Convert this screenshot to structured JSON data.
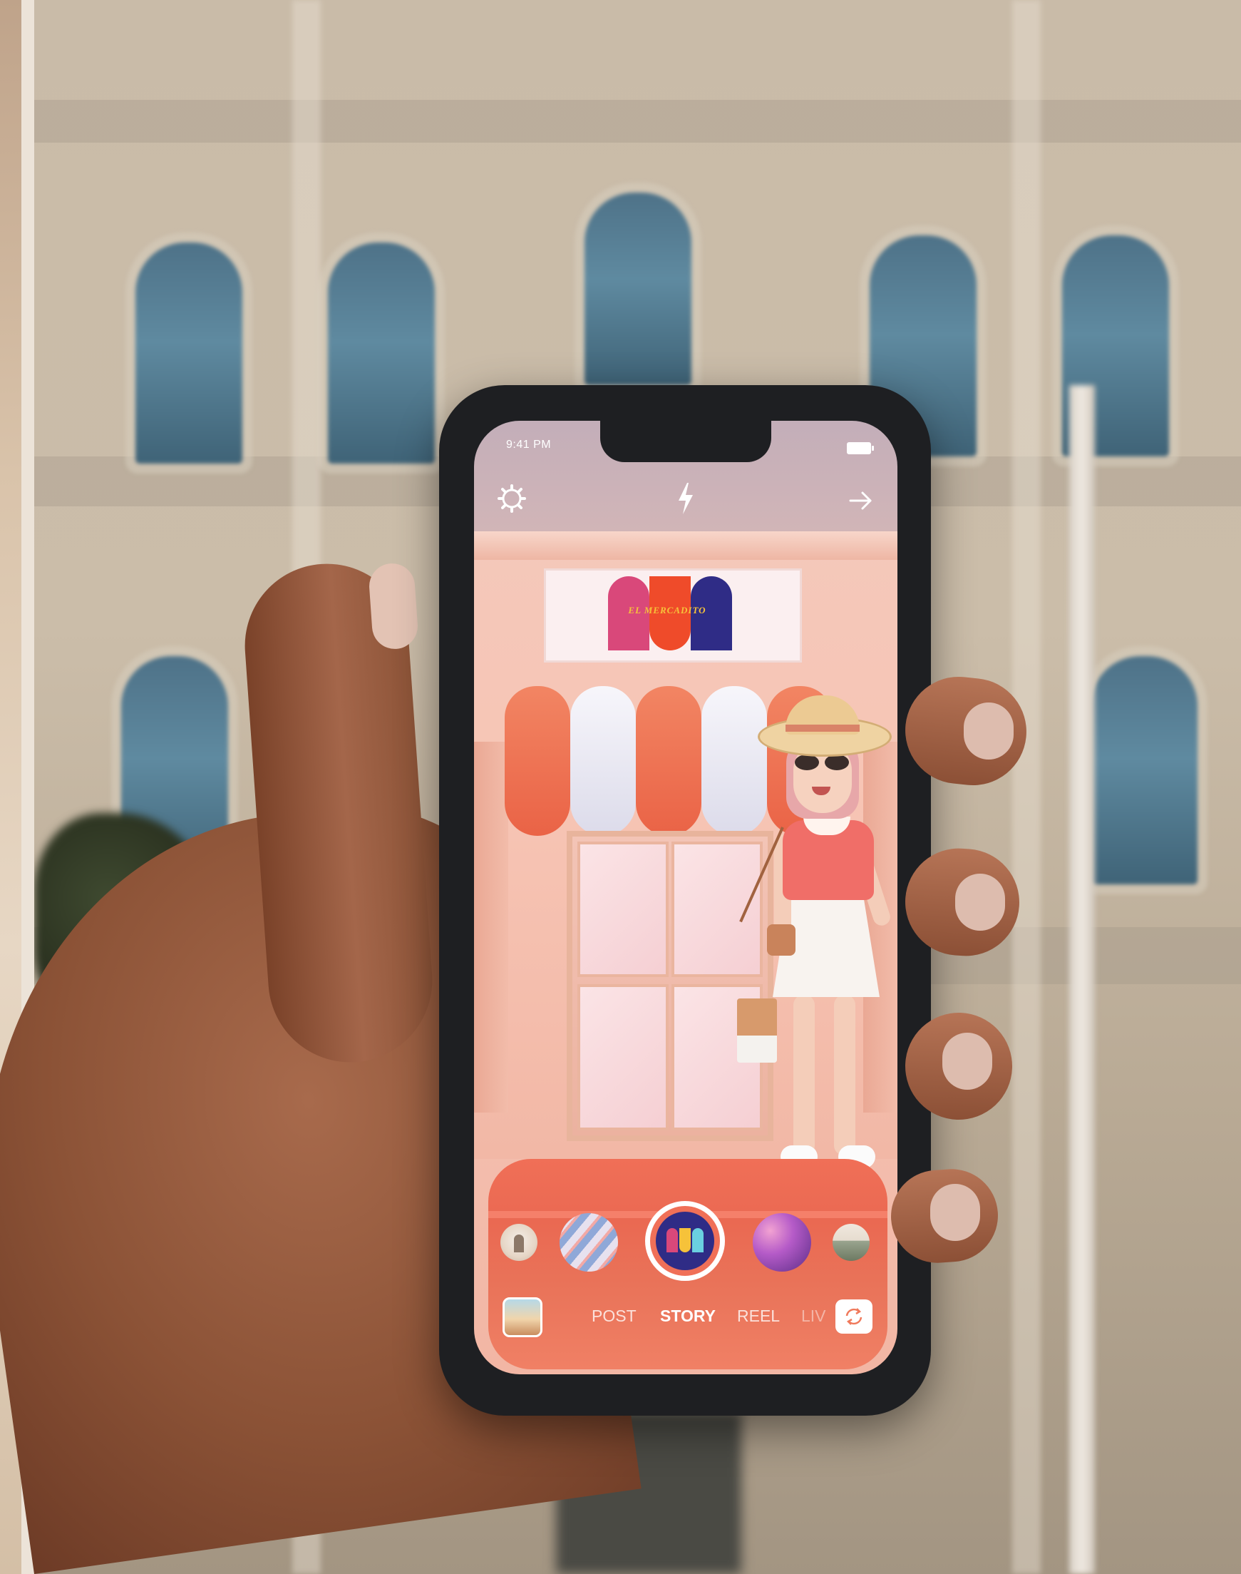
{
  "status_bar": {
    "time": "9:41 PM"
  },
  "top_bar": {
    "settings_icon": "settings-gear-icon",
    "flash_icon": "flash-bolt-icon",
    "forward_icon": "arrow-right-icon"
  },
  "store": {
    "sign_text": "EL MERCADITO"
  },
  "filters": {
    "items": [
      "door-filter",
      "swirl-filter",
      "el-mercadito-filter",
      "sunset-filter",
      "street-filter"
    ],
    "selected": "el-mercadito-filter"
  },
  "modes": {
    "items": [
      {
        "label": "POST",
        "active": false
      },
      {
        "label": "STORY",
        "active": true
      },
      {
        "label": "REEL",
        "active": false
      },
      {
        "label": "LIV",
        "active": false
      }
    ]
  },
  "bottom_bar": {
    "gallery_icon": "gallery-thumbnail",
    "flip_icon": "camera-flip-icon"
  },
  "colors": {
    "awning_orange": "#f0714f",
    "awning_white": "#eae9f4",
    "logo_pink": "#d9487a",
    "logo_orange": "#ef4b2a",
    "logo_navy": "#2f2c86",
    "sign_text_yellow": "#f6c23a"
  }
}
